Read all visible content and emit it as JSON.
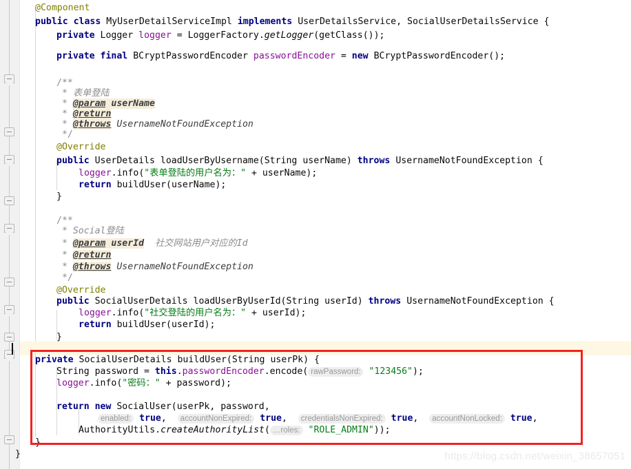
{
  "app": {
    "kind": "code-editor",
    "language": "Java",
    "watermark": "https://blog.csdn.net/weixin_38657051",
    "colors": {
      "background": "#ffffff",
      "gutter": "#f1f1f1",
      "current_line": "#fdf7e3",
      "annotation_box": "#f32121",
      "keyword": "#000080",
      "string": "#067d17",
      "comment": "#8c8c8c",
      "field": "#871094",
      "annotation": "#808000",
      "javadoc_tag_highlight": "#f5eedc",
      "param_hint_pill": "#eeeeee"
    }
  },
  "code": {
    "lines": [
      {
        "indent": 0,
        "text": "@Component"
      },
      {
        "indent": 0,
        "text": "public class MyUserDetailServiceImpl implements UserDetailsService, SocialUserDetailsService {"
      },
      {
        "indent": 1,
        "text": "private Logger logger = LoggerFactory.getLogger(getClass());"
      },
      {
        "indent": 0,
        "text": ""
      },
      {
        "indent": 1,
        "text": "private final BCryptPasswordEncoder passwordEncoder = new BCryptPasswordEncoder();"
      },
      {
        "indent": 0,
        "text": ""
      },
      {
        "indent": 1,
        "text": "/**"
      },
      {
        "indent": 1,
        "text": " * 表单登陆"
      },
      {
        "indent": 1,
        "text": " * @param userName"
      },
      {
        "indent": 1,
        "text": " * @return"
      },
      {
        "indent": 1,
        "text": " * @throws UsernameNotFoundException"
      },
      {
        "indent": 1,
        "text": " */"
      },
      {
        "indent": 1,
        "text": "@Override"
      },
      {
        "indent": 1,
        "text": "public UserDetails loadUserByUsername(String userName) throws UsernameNotFoundException {"
      },
      {
        "indent": 2,
        "text": "logger.info(\"表单登陆的用户名为：\" + userName);"
      },
      {
        "indent": 2,
        "text": "return buildUser(userName);"
      },
      {
        "indent": 1,
        "text": "}"
      },
      {
        "indent": 0,
        "text": ""
      },
      {
        "indent": 1,
        "text": "/**"
      },
      {
        "indent": 1,
        "text": " * Social登陆"
      },
      {
        "indent": 1,
        "text": " * @param userId 社交网站用户对应的Id"
      },
      {
        "indent": 1,
        "text": " * @return"
      },
      {
        "indent": 1,
        "text": " * @throws UsernameNotFoundException"
      },
      {
        "indent": 1,
        "text": " */"
      },
      {
        "indent": 1,
        "text": "@Override"
      },
      {
        "indent": 1,
        "text": "public SocialUserDetails loadUserByUserId(String userId) throws UsernameNotFoundException {"
      },
      {
        "indent": 2,
        "text": "logger.info(\"社交登陆的用户名为：\" + userId);"
      },
      {
        "indent": 2,
        "text": "return buildUser(userId);"
      },
      {
        "indent": 1,
        "text": "}"
      },
      {
        "indent": 0,
        "text": ""
      },
      {
        "indent": 1,
        "text": "private SocialUserDetails buildUser(String userPk) {"
      },
      {
        "indent": 2,
        "text": "String password = this.passwordEncoder.encode( rawPassword: \"123456\");"
      },
      {
        "indent": 2,
        "text": "logger.info(\"密码：\" + password);"
      },
      {
        "indent": 0,
        "text": ""
      },
      {
        "indent": 2,
        "text": "return new SocialUser(userPk, password,"
      },
      {
        "indent": 3,
        "text": "enabled: true,  accountNonExpired: true,  credentialsNonExpired: true,  accountNonLocked: true,"
      },
      {
        "indent": 3,
        "text": "AuthorityUtils.createAuthorityList( ...roles: \"ROLE_ADMIN\"));"
      },
      {
        "indent": 1,
        "text": "}"
      },
      {
        "indent": 0,
        "text": "}"
      }
    ],
    "tokens": {
      "keywords": [
        "public",
        "class",
        "implements",
        "private",
        "final",
        "new",
        "return",
        "throws"
      ],
      "annotations": [
        "@Component",
        "@Override"
      ],
      "javadoc_tags": [
        "@param",
        "@return",
        "@throws"
      ],
      "strings": [
        "\"表单登陆的用户名为：\"",
        "\"社交登陆的用户名为：\"",
        "\"密码：\"",
        "\"123456\"",
        "\"ROLE_ADMIN\""
      ],
      "parameter_hints": [
        "rawPassword:",
        "enabled:",
        "accountNonExpired:",
        "credentialsNonExpired:",
        "accountNonLocked:",
        "...roles:"
      ]
    },
    "class_name": "MyUserDetailServiceImpl",
    "interfaces": [
      "UserDetailsService",
      "SocialUserDetailsService"
    ],
    "methods": [
      "loadUserByUsername",
      "loadUserByUserId",
      "buildUser"
    ]
  },
  "annotation": {
    "highlight_note": "red rectangle around buildUser method"
  }
}
